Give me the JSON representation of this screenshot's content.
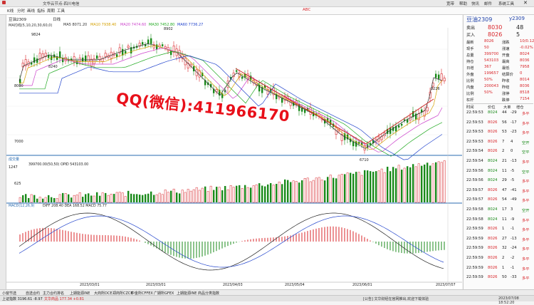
{
  "titlebar": {
    "title": "文华云节点-四川电信",
    "menu_right": [
      "宽带",
      "帮助",
      "快讯",
      "邮件",
      "系统工具",
      "帮助"
    ]
  },
  "menubar": {
    "items": [
      "K线",
      "分时",
      "画线",
      "指标",
      "周期",
      "工具",
      "ABC"
    ]
  },
  "chart_header": {
    "symbol": "豆油2309",
    "period": "日线",
    "ma_label": "MA均线(5,10,20,30,60,0)",
    "ma5": "MA5 8071.20",
    "ma10": "MA10 7938.40",
    "ma20": "MA20 7474.60",
    "ma30": "MA30 7452.80",
    "ma60": "MA60 7736.27",
    "ma_colors": [
      "#333333",
      "#d4a000",
      "#cc44cc",
      "#22aa22",
      "#2244cc"
    ]
  },
  "main_chart": {
    "ylabels": [
      "8500",
      "8000",
      "7500",
      "7000"
    ],
    "annotations": [
      "9824",
      "8240",
      "8902",
      "8226",
      "6710"
    ],
    "watermark": "QQ(微信):411966170"
  },
  "volume_chart": {
    "label": "成交量",
    "values_text": "399700.00(50,50)   OPID 543103.00",
    "ylabels": [
      "1247",
      "625",
      "0"
    ]
  },
  "macd_chart": {
    "label": "MACD(12,26,9)",
    "values_text": "DIFF 208.40   DEA 168.52   MACD 75.77"
  },
  "xaxis": {
    "labels": [
      "2023/03/01",
      "2023/03/01",
      "2023/04/03",
      "2023/05/04",
      "2023/06/01",
      "2023/07/07"
    ]
  },
  "right_panel": {
    "title": "豆油2309",
    "code": "y2309",
    "sell_label": "卖出",
    "sell_price": "8030",
    "sell_vol": "48",
    "buy_label": "买入",
    "buy_price": "8026",
    "buy_vol": "5",
    "quote_rows": [
      {
        "l1": "最新",
        "v1": "8026",
        "l2": "涨跌",
        "v2": "10/0.12%"
      },
      {
        "l1": "现手",
        "v1": "50",
        "l2": "涨速",
        "v2": "-0.02%"
      },
      {
        "l1": "总量",
        "v1": "399700",
        "l2": "开盘",
        "v2": "8024"
      },
      {
        "l1": "持仓",
        "v1": "543103",
        "l2": "最高",
        "v2": "8036"
      },
      {
        "l1": "日增",
        "v1": "367",
        "l2": "最低",
        "v2": "7958"
      },
      {
        "l1": "外盘",
        "v1": "199657",
        "l2": "结算价",
        "v2": "0"
      },
      {
        "l1": "比例",
        "v1": "50%",
        "l2": "昨收",
        "v2": "8014"
      },
      {
        "l1": "内盘",
        "v1": "200043",
        "l2": "昨结",
        "v2": "8036"
      },
      {
        "l1": "比例",
        "v1": "50%",
        "l2": "涨停",
        "v2": "8518"
      },
      {
        "l1": "杠杆",
        "v1": "",
        "l2": "跌停",
        "v2": "7154"
      }
    ],
    "ticks_header": [
      "时间",
      "价位",
      "大单",
      "增仓"
    ],
    "ticks": [
      {
        "time": "22:59:53",
        "price": "8024",
        "vol": "44",
        "inc": "-29",
        "type": "多平"
      },
      {
        "time": "22:59:53",
        "price": "8026",
        "vol": "56",
        "inc": "-17",
        "type": "多平"
      },
      {
        "time": "22:59:53",
        "price": "8026",
        "vol": "53",
        "inc": "-23",
        "type": "多平"
      },
      {
        "time": "22:59:53",
        "price": "8026",
        "vol": "7",
        "inc": "4",
        "type": "空开"
      },
      {
        "time": "22:59:54",
        "price": "8026",
        "vol": "2",
        "inc": "0",
        "type": "空平"
      },
      {
        "time": "22:59:54",
        "price": "8024",
        "vol": "21",
        "inc": "-13",
        "type": "多平"
      },
      {
        "time": "22:59:56",
        "price": "8024",
        "vol": "11",
        "inc": "-5",
        "type": "空平"
      },
      {
        "time": "22:59:56",
        "price": "8024",
        "vol": "29",
        "inc": "-5",
        "type": "多平"
      },
      {
        "time": "22:59:57",
        "price": "8026",
        "vol": "47",
        "inc": "-41",
        "type": "多平"
      },
      {
        "time": "22:59:57",
        "price": "8026",
        "vol": "54",
        "inc": "-49",
        "type": "多平"
      },
      {
        "time": "22:59:58",
        "price": "8024",
        "vol": "17",
        "inc": "3",
        "type": "空开"
      },
      {
        "time": "22:59:58",
        "price": "8024",
        "vol": "11",
        "inc": "-9",
        "type": "多平"
      },
      {
        "time": "22:59:59",
        "price": "8026",
        "vol": "1",
        "inc": "-1",
        "type": "多平"
      },
      {
        "time": "22:59:59",
        "price": "8026",
        "vol": "27",
        "inc": "-13",
        "type": "多平"
      },
      {
        "time": "22:59:59",
        "price": "8026",
        "vol": "32",
        "inc": "-24",
        "type": "多平"
      },
      {
        "time": "22:59:59",
        "price": "8026",
        "vol": "2",
        "inc": "-2",
        "type": "多平"
      },
      {
        "time": "22:59:59",
        "price": "8026",
        "vol": "1",
        "inc": "-1",
        "type": "多平"
      },
      {
        "time": "22:59:59",
        "price": "8026",
        "vol": "50",
        "inc": "-33",
        "type": "多平"
      }
    ]
  },
  "bottom_tabs": [
    "小窗节选",
    "自选合约",
    "主力合约排名",
    "上期能源INE",
    "大商所DCE",
    "郑商所CZCE",
    "中金所CFFEX",
    "广期所GFEX",
    "上期能源INE",
    "商品分类指数"
  ],
  "status": {
    "left": "上证指数 3196.61  -8.97",
    "mid": "文华商品 177.34  +0.81",
    "right_notice": "[公告] 文华财经在官网推出,欢迎下载体验",
    "time": "18:52",
    "date": "2023/07/08 18:52:20"
  }
}
